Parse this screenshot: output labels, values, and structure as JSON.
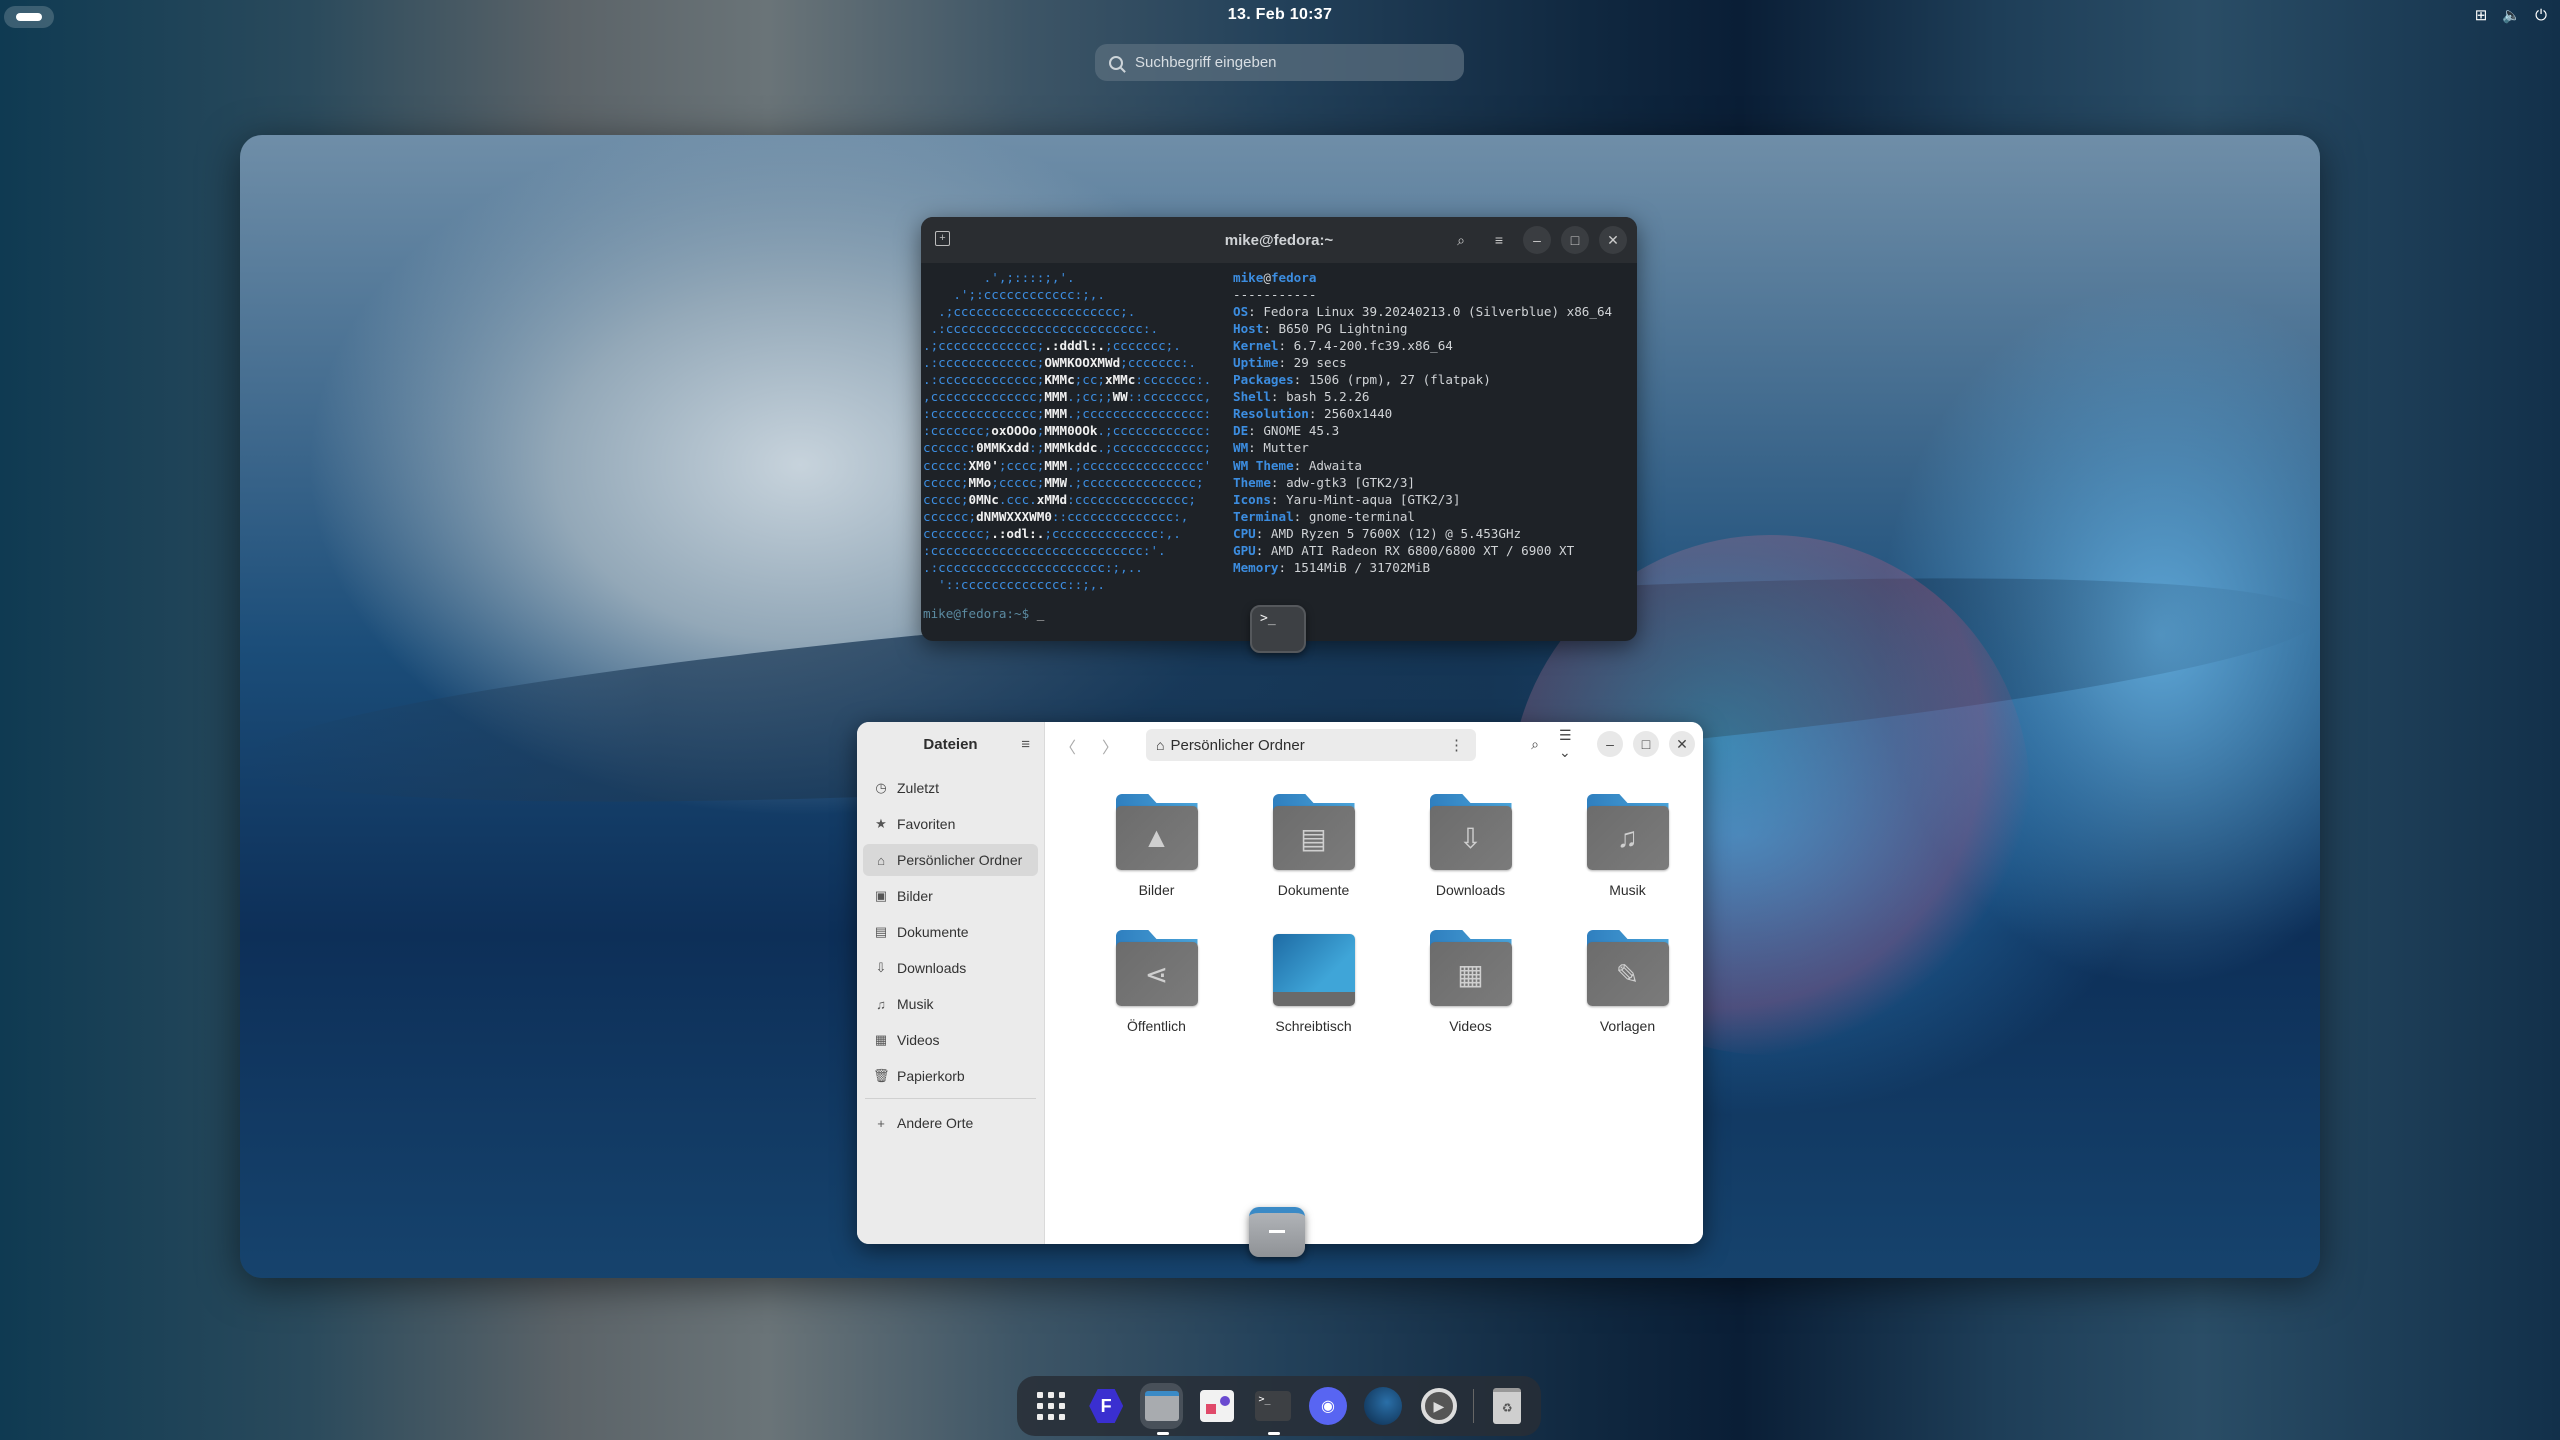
{
  "topbar": {
    "activities": "activities-pill",
    "clock": "13. Feb  10:37",
    "tray": [
      "network-icon",
      "volume-icon",
      "power-icon"
    ]
  },
  "search": {
    "placeholder": "Suchbegriff eingeben"
  },
  "terminal": {
    "title": "mike@fedora:~",
    "logo": [
      "        .',;::::;,'.",
      "    .';:cccccccccccc:;,.",
      "  .;cccccccccccccccccccccc;.",
      " .:cccccccccccccccccccccccccc:.",
      ".;ccccccccccccc;.:dddl:.;ccccccc;.",
      ".:ccccccccccccc;OWMKOOXMWd;ccccccc:.",
      ".:ccccccccccccc;KMMc;cc;xMMc:ccccccc:.",
      ",cccccccccccccc;MMM.;cc;;WW::cccccccc,",
      ":cccccccccccccc;MMM.;cccccccccccccccc:",
      ":ccccccc;oxOOOo;MMM0OOk.;cccccccccccc:",
      "cccccc:0MMKxdd:;MMMkddc.;cccccccccccc;",
      "ccccc:XM0';cccc;MMM.;cccccccccccccccc'",
      "ccccc;MMo;ccccc;MMW.;ccccccccccccccc;",
      "ccccc;0MNc.ccc.xMMd:ccccccccccccccc;",
      "cccccc;dNMWXXXWM0::cccccccccccccc:,",
      "cccccccc;.:odl:.;cccccccccccccc:,.",
      ":cccccccccccccccccccccccccccc:'.",
      ".:cccccccccccccccccccccc:;,..",
      "  '::cccccccccccccc::;,."
    ],
    "user": "mike",
    "host": "fedora",
    "separator": "-----------",
    "info": [
      {
        "k": "OS",
        "v": "Fedora Linux 39.20240213.0 (Silverblue) x86_64"
      },
      {
        "k": "Host",
        "v": "B650 PG Lightning"
      },
      {
        "k": "Kernel",
        "v": "6.7.4-200.fc39.x86_64"
      },
      {
        "k": "Uptime",
        "v": "29 secs"
      },
      {
        "k": "Packages",
        "v": "1506 (rpm), 27 (flatpak)"
      },
      {
        "k": "Shell",
        "v": "bash 5.2.26"
      },
      {
        "k": "Resolution",
        "v": "2560x1440"
      },
      {
        "k": "DE",
        "v": "GNOME 45.3"
      },
      {
        "k": "WM",
        "v": "Mutter"
      },
      {
        "k": "WM Theme",
        "v": "Adwaita"
      },
      {
        "k": "Theme",
        "v": "adw-gtk3 [GTK2/3]"
      },
      {
        "k": "Icons",
        "v": "Yaru-Mint-aqua [GTK2/3]"
      },
      {
        "k": "Terminal",
        "v": "gnome-terminal"
      },
      {
        "k": "CPU",
        "v": "AMD Ryzen 5 7600X (12) @ 5.453GHz"
      },
      {
        "k": "GPU",
        "v": "AMD ATI Radeon RX 6800/6800 XT / 6900 XT"
      },
      {
        "k": "Memory",
        "v": "1514MiB / 31702MiB"
      }
    ],
    "prompt": "mike@fedora:~$ ",
    "cursor": "_",
    "window_icon": ">_"
  },
  "files": {
    "app_title": "Dateien",
    "path": "Persönlicher Ordner",
    "sidebar": [
      {
        "label": "Zuletzt",
        "icon": "◷"
      },
      {
        "label": "Favoriten",
        "icon": "★"
      },
      {
        "label": "Persönlicher Ordner",
        "icon": "⌂",
        "selected": true
      },
      {
        "label": "Bilder",
        "icon": "▣"
      },
      {
        "label": "Dokumente",
        "icon": "▤"
      },
      {
        "label": "Downloads",
        "icon": "⇩"
      },
      {
        "label": "Musik",
        "icon": "♫"
      },
      {
        "label": "Videos",
        "icon": "▦"
      },
      {
        "label": "Papierkorb",
        "icon": "🗑"
      }
    ],
    "other_places": "Andere Orte",
    "items": [
      {
        "label": "Bilder",
        "glyph": "▲"
      },
      {
        "label": "Dokumente",
        "glyph": "▤"
      },
      {
        "label": "Downloads",
        "glyph": "⇩"
      },
      {
        "label": "Musik",
        "glyph": "♫"
      },
      {
        "label": "Öffentlich",
        "glyph": "⋖"
      },
      {
        "label": "Schreibtisch",
        "glyph": ""
      },
      {
        "label": "Videos",
        "glyph": "▦"
      },
      {
        "label": "Vorlagen",
        "glyph": "✎"
      }
    ]
  },
  "dock": [
    "app-grid",
    "fedora-media-writer",
    "files",
    "software",
    "terminal",
    "discord",
    "steam",
    "settings",
    "trash"
  ]
}
